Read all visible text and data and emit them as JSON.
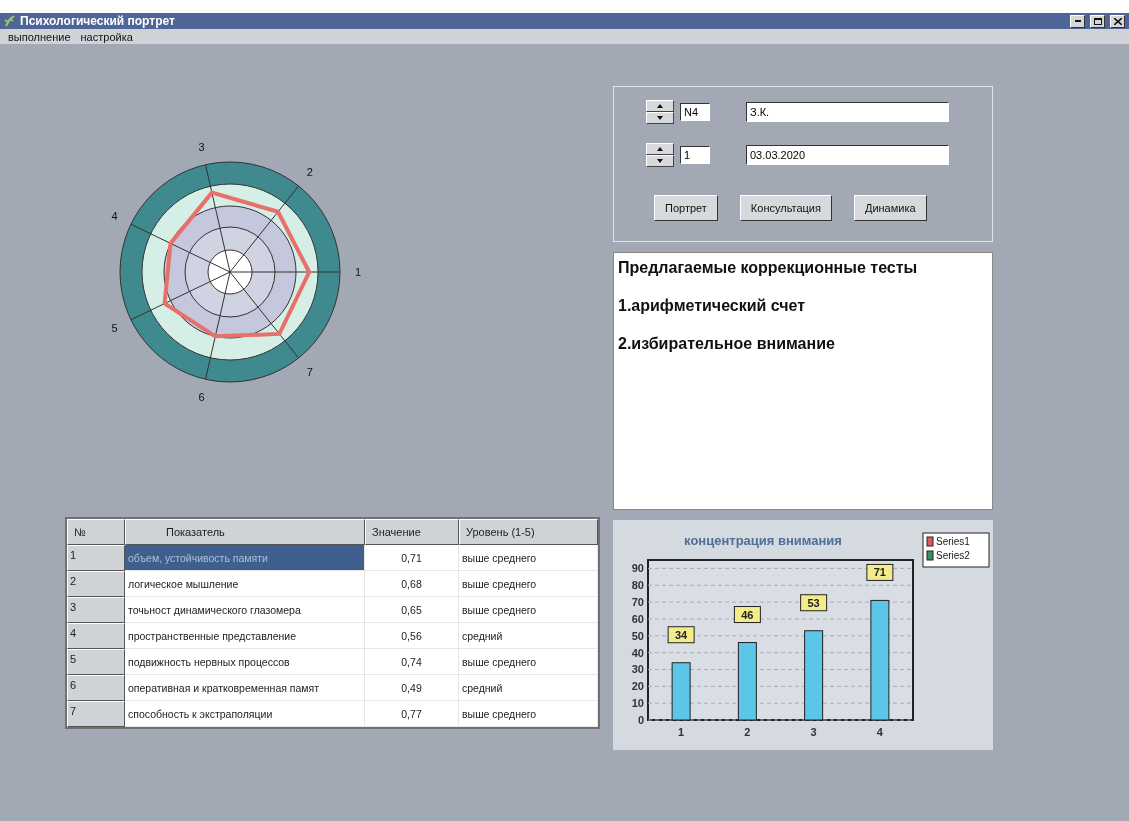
{
  "window": {
    "title": "Психологический портрет"
  },
  "menu": [
    {
      "label": "выполнение"
    },
    {
      "label": "настройка"
    }
  ],
  "radar": {
    "axis_labels": [
      "1",
      "2",
      "3",
      "4",
      "5",
      "6",
      "7"
    ]
  },
  "controls": {
    "rows": [
      {
        "number": "N4",
        "text": "З.К."
      },
      {
        "number": "1",
        "text": "03.03.2020"
      }
    ],
    "buttons": [
      "Портрет",
      "Консультация",
      "Динамика"
    ]
  },
  "recommendations": {
    "lines": [
      "Предлагаемые коррекционные тесты",
      "1.арифметический счет",
      "2.избирательное внимание"
    ]
  },
  "table": {
    "columns": [
      "№",
      "Показатель",
      "Значение",
      "Уровень (1-5)"
    ],
    "rows": [
      {
        "cells": [
          "1",
          "объем, устойчивость памяти",
          "0,71",
          "выше среднего"
        ],
        "selected": true
      },
      {
        "cells": [
          "2",
          "логическое мышление",
          "0,68",
          "выше среднего"
        ],
        "selected": false
      },
      {
        "cells": [
          "3",
          "точьност динамического глазомера",
          "0,65",
          "выше среднего"
        ],
        "selected": false
      },
      {
        "cells": [
          "4",
          "пространственные представление",
          "0,56",
          "средний"
        ],
        "selected": false
      },
      {
        "cells": [
          "5",
          "подвижность нервных процессов",
          "0,74",
          "выше среднего"
        ],
        "selected": false
      },
      {
        "cells": [
          "6",
          "оперативная и кратковременная памят",
          "0,49",
          "средний"
        ],
        "selected": false
      },
      {
        "cells": [
          "7",
          "способность к экстраполяции",
          "0,77",
          "выше среднего"
        ],
        "selected": false
      }
    ]
  },
  "chart": {
    "chart_data": {
      "type": "bar",
      "title": "концентрация внимания",
      "categories": [
        "1",
        "2",
        "3",
        "4"
      ],
      "values": [
        34,
        46,
        53,
        71
      ],
      "ylim": [
        0,
        95
      ],
      "yticks": [
        0,
        10,
        20,
        30,
        40,
        50,
        60,
        70,
        80,
        90
      ],
      "data_labels": true,
      "grid": true
    },
    "legend": [
      {
        "label": "Series1",
        "color": "#d9605a"
      },
      {
        "label": "Series2",
        "color": "#3f8a6a"
      }
    ]
  }
}
